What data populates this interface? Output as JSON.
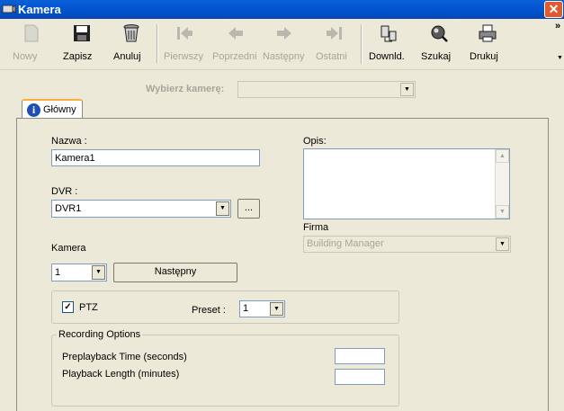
{
  "window": {
    "title": "Kamera",
    "close_glyph": "✕"
  },
  "toolbar": {
    "buttons": [
      {
        "label": "Nowy",
        "icon": "new-document-icon",
        "enabled": false
      },
      {
        "label": "Zapisz",
        "icon": "floppy-disk-icon",
        "enabled": true
      },
      {
        "label": "Anuluj",
        "icon": "trash-bin-icon",
        "enabled": true
      },
      {
        "label": "Pierwszy",
        "icon": "first-record-icon",
        "enabled": false
      },
      {
        "label": "Poprzedni",
        "icon": "previous-arrow-icon",
        "enabled": false
      },
      {
        "label": "Następny",
        "icon": "next-arrow-icon",
        "enabled": false
      },
      {
        "label": "Ostatni",
        "icon": "last-record-icon",
        "enabled": false
      },
      {
        "label": "Downld.",
        "icon": "download-icon",
        "enabled": true
      },
      {
        "label": "Szukaj",
        "icon": "search-globe-icon",
        "enabled": true
      },
      {
        "label": "Drukuj",
        "icon": "printer-icon",
        "enabled": true
      }
    ],
    "overflow_glyph": "»",
    "menu_arrow": "▼"
  },
  "camera_select": {
    "label": "Wybierz kamerę:",
    "value": ""
  },
  "tabs": [
    {
      "label": "Główny",
      "icon": "info-icon",
      "active": true
    }
  ],
  "form": {
    "name_label": "Nazwa :",
    "name_value": "Kamera1",
    "dvr_label": "DVR :",
    "dvr_value": "DVR1",
    "dvr_browse_label": "...",
    "camera_label": "Kamera",
    "camera_value": "1",
    "next_button_label": "Następny",
    "description_label": "Opis:",
    "description_value": "",
    "company_label": "Firma",
    "company_value": "Building Manager",
    "ptz_label": "PTZ",
    "ptz_checked": true,
    "preset_label": "Preset :",
    "preset_value": "1",
    "recording_options_legend": "Recording Options",
    "preplayback_label": "Preplayback Time (seconds)",
    "preplayback_value": "",
    "playback_length_label": "Playback Length (minutes)",
    "playback_length_value": ""
  },
  "colors": {
    "titlebar": "#0052cc",
    "window_bg": "#ece9d8",
    "tab_accent": "#f5b13b",
    "close_button": "#e05a2d"
  }
}
